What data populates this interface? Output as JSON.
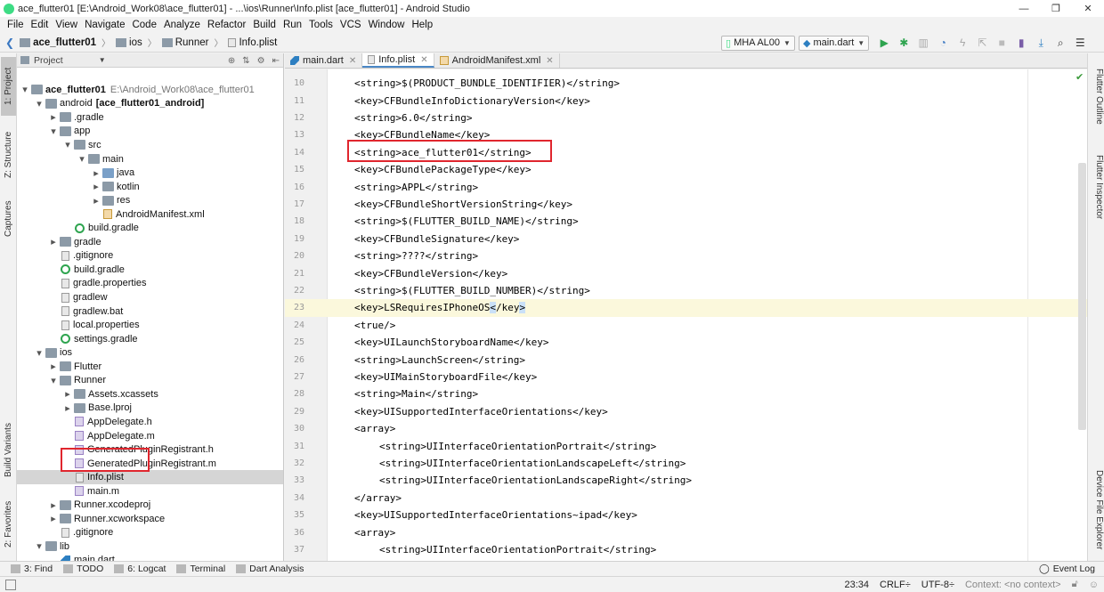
{
  "window": {
    "title": "ace_flutter01 [E:\\Android_Work08\\ace_flutter01] - ...\\ios\\Runner\\Info.plist [ace_flutter01] - Android Studio",
    "minimize": "—",
    "maximize": "❐",
    "close": "✕"
  },
  "menu": [
    "File",
    "Edit",
    "View",
    "Navigate",
    "Code",
    "Analyze",
    "Refactor",
    "Build",
    "Run",
    "Tools",
    "VCS",
    "Window",
    "Help"
  ],
  "breadcrumbs": [
    "ace_flutter01",
    "ios",
    "Runner",
    "Info.plist"
  ],
  "run_config": {
    "device": "MHA AL00",
    "target": "main.dart"
  },
  "left_strip": {
    "project": "1: Project",
    "structure": "Z: Structure",
    "captures": "Captures",
    "build_variants": "Build Variants",
    "favorites": "2: Favorites"
  },
  "right_strip": {
    "flutter_outline": "Flutter Outline",
    "flutter_inspector": "Flutter Inspector",
    "device_file_explorer": "Device File Explorer"
  },
  "project_panel": {
    "header": "Project",
    "tree": [
      {
        "label": "ace_flutter01",
        "extra": "E:\\Android_Work08\\ace_flutter01",
        "depth": 0,
        "arrow": "down",
        "icon": "folder",
        "bold": true
      },
      {
        "label": "android",
        "extra": "[ace_flutter01_android]",
        "depth": 1,
        "arrow": "down",
        "icon": "folder",
        "extra_bold": true
      },
      {
        "label": ".gradle",
        "depth": 2,
        "arrow": "right",
        "icon": "folder"
      },
      {
        "label": "app",
        "depth": 2,
        "arrow": "down",
        "icon": "folder"
      },
      {
        "label": "src",
        "depth": 3,
        "arrow": "down",
        "icon": "folder"
      },
      {
        "label": "main",
        "depth": 4,
        "arrow": "down",
        "icon": "folder"
      },
      {
        "label": "java",
        "depth": 5,
        "arrow": "right",
        "icon": "folder-blue"
      },
      {
        "label": "kotlin",
        "depth": 5,
        "arrow": "right",
        "icon": "folder"
      },
      {
        "label": "res",
        "depth": 5,
        "arrow": "right",
        "icon": "folder"
      },
      {
        "label": "AndroidManifest.xml",
        "depth": 5,
        "arrow": "none",
        "icon": "xml"
      },
      {
        "label": "build.gradle",
        "depth": 3,
        "arrow": "none",
        "icon": "gradle"
      },
      {
        "label": "gradle",
        "depth": 2,
        "arrow": "right",
        "icon": "folder"
      },
      {
        "label": ".gitignore",
        "depth": 2,
        "arrow": "none",
        "icon": "file"
      },
      {
        "label": "build.gradle",
        "depth": 2,
        "arrow": "none",
        "icon": "gradle"
      },
      {
        "label": "gradle.properties",
        "depth": 2,
        "arrow": "none",
        "icon": "file"
      },
      {
        "label": "gradlew",
        "depth": 2,
        "arrow": "none",
        "icon": "file"
      },
      {
        "label": "gradlew.bat",
        "depth": 2,
        "arrow": "none",
        "icon": "file"
      },
      {
        "label": "local.properties",
        "depth": 2,
        "arrow": "none",
        "icon": "file"
      },
      {
        "label": "settings.gradle",
        "depth": 2,
        "arrow": "none",
        "icon": "gradle"
      },
      {
        "label": "ios",
        "depth": 1,
        "arrow": "down",
        "icon": "folder"
      },
      {
        "label": "Flutter",
        "depth": 2,
        "arrow": "right",
        "icon": "folder"
      },
      {
        "label": "Runner",
        "depth": 2,
        "arrow": "down",
        "icon": "folder"
      },
      {
        "label": "Assets.xcassets",
        "depth": 3,
        "arrow": "right",
        "icon": "folder"
      },
      {
        "label": "Base.lproj",
        "depth": 3,
        "arrow": "right",
        "icon": "folder"
      },
      {
        "label": "AppDelegate.h",
        "depth": 3,
        "arrow": "none",
        "icon": "c"
      },
      {
        "label": "AppDelegate.m",
        "depth": 3,
        "arrow": "none",
        "icon": "c"
      },
      {
        "label": "GeneratedPluginRegistrant.h",
        "depth": 3,
        "arrow": "none",
        "icon": "c"
      },
      {
        "label": "GeneratedPluginRegistrant.m",
        "depth": 3,
        "arrow": "none",
        "icon": "c"
      },
      {
        "label": "Info.plist",
        "depth": 3,
        "arrow": "none",
        "icon": "file",
        "selected": true
      },
      {
        "label": "main.m",
        "depth": 3,
        "arrow": "none",
        "icon": "c"
      },
      {
        "label": "Runner.xcodeproj",
        "depth": 2,
        "arrow": "right",
        "icon": "folder"
      },
      {
        "label": "Runner.xcworkspace",
        "depth": 2,
        "arrow": "right",
        "icon": "folder"
      },
      {
        "label": ".gitignore",
        "depth": 2,
        "arrow": "none",
        "icon": "file"
      },
      {
        "label": "lib",
        "depth": 1,
        "arrow": "down",
        "icon": "folder"
      },
      {
        "label": "main.dart",
        "depth": 2,
        "arrow": "none",
        "icon": "dart"
      },
      {
        "label": "test",
        "depth": 1,
        "arrow": "right",
        "icon": "folder"
      }
    ]
  },
  "editor_tabs": [
    {
      "label": "main.dart",
      "icon": "dart",
      "active": false
    },
    {
      "label": "Info.plist",
      "icon": "file",
      "active": true
    },
    {
      "label": "AndroidManifest.xml",
      "icon": "xml",
      "active": false
    }
  ],
  "code_lines": [
    {
      "num": "10",
      "indent": 1,
      "text": "<string>$(PRODUCT_BUNDLE_IDENTIFIER)</string>"
    },
    {
      "num": "11",
      "indent": 1,
      "text": "<key>CFBundleInfoDictionaryVersion</key>"
    },
    {
      "num": "12",
      "indent": 1,
      "text": "<string>6.0</string>"
    },
    {
      "num": "13",
      "indent": 1,
      "text": "<key>CFBundleName</key>"
    },
    {
      "num": "14",
      "indent": 1,
      "text": "<string>ace_flutter01</string>"
    },
    {
      "num": "15",
      "indent": 1,
      "text": "<key>CFBundlePackageType</key>"
    },
    {
      "num": "16",
      "indent": 1,
      "text": "<string>APPL</string>"
    },
    {
      "num": "17",
      "indent": 1,
      "text": "<key>CFBundleShortVersionString</key>"
    },
    {
      "num": "18",
      "indent": 1,
      "text": "<string>$(FLUTTER_BUILD_NAME)</string>"
    },
    {
      "num": "19",
      "indent": 1,
      "text": "<key>CFBundleSignature</key>"
    },
    {
      "num": "20",
      "indent": 1,
      "text": "<string>????</string>"
    },
    {
      "num": "21",
      "indent": 1,
      "text": "<key>CFBundleVersion</key>"
    },
    {
      "num": "22",
      "indent": 1,
      "text": "<string>$(FLUTTER_BUILD_NUMBER)</string>"
    },
    {
      "num": "23",
      "indent": 1,
      "text": "<key>LSRequiresIPhoneOS</key>",
      "current": true
    },
    {
      "num": "24",
      "indent": 1,
      "text": "<true/>"
    },
    {
      "num": "25",
      "indent": 1,
      "text": "<key>UILaunchStoryboardName</key>"
    },
    {
      "num": "26",
      "indent": 1,
      "text": "<string>LaunchScreen</string>"
    },
    {
      "num": "27",
      "indent": 1,
      "text": "<key>UIMainStoryboardFile</key>"
    },
    {
      "num": "28",
      "indent": 1,
      "text": "<string>Main</string>"
    },
    {
      "num": "29",
      "indent": 1,
      "text": "<key>UISupportedInterfaceOrientations</key>"
    },
    {
      "num": "30",
      "indent": 1,
      "text": "<array>"
    },
    {
      "num": "31",
      "indent": 2,
      "text": "<string>UIInterfaceOrientationPortrait</string>"
    },
    {
      "num": "32",
      "indent": 2,
      "text": "<string>UIInterfaceOrientationLandscapeLeft</string>"
    },
    {
      "num": "33",
      "indent": 2,
      "text": "<string>UIInterfaceOrientationLandscapeRight</string>"
    },
    {
      "num": "34",
      "indent": 1,
      "text": "</array>"
    },
    {
      "num": "35",
      "indent": 1,
      "text": "<key>UISupportedInterfaceOrientations~ipad</key>"
    },
    {
      "num": "36",
      "indent": 1,
      "text": "<array>"
    },
    {
      "num": "37",
      "indent": 2,
      "text": "<string>UIInterfaceOrientationPortrait</string>"
    }
  ],
  "bottom_tools": [
    {
      "label": "3: Find",
      "icon": "search-icon"
    },
    {
      "label": "TODO",
      "icon": "todo-icon"
    },
    {
      "label": "6: Logcat",
      "icon": "logcat-icon"
    },
    {
      "label": "Terminal",
      "icon": "terminal-icon"
    },
    {
      "label": "Dart Analysis",
      "icon": "dart-icon"
    }
  ],
  "event_log": "Event Log",
  "status": {
    "position": "23:34",
    "line_sep": "CRLF÷",
    "encoding": "UTF-8÷",
    "context": "Context: <no context>"
  },
  "colors": {
    "highlight_box": "#e0262e",
    "current_line": "#fbf8dc",
    "run_green": "#2ea44f",
    "tab_underline": "#4a88c7"
  }
}
